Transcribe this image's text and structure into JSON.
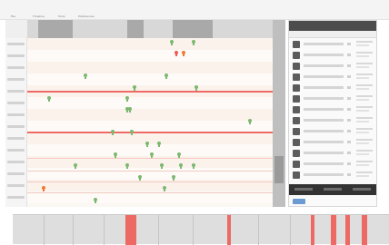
{
  "menubar": {
    "items": [
      {
        "label": "File"
      },
      {
        "label": "Timeline"
      },
      {
        "label": "Tools"
      },
      {
        "label": "Preferences"
      }
    ]
  },
  "timeline": {
    "lanes": 14,
    "markers": [
      {
        "color": "#7cb86f",
        "lane": 3,
        "t": 0.23
      },
      {
        "color": "#7cb86f",
        "lane": 5,
        "t": 0.08
      },
      {
        "color": "#7cb86f",
        "lane": 4,
        "t": 0.43
      },
      {
        "color": "#7cb86f",
        "lane": 3,
        "t": 0.56
      },
      {
        "color": "#7cb86f",
        "lane": 4,
        "t": 0.68
      },
      {
        "color": "#7cb86f",
        "lane": 0,
        "t": 0.58
      },
      {
        "color": "#ef5a50",
        "lane": 1,
        "t": 0.6
      },
      {
        "color": "#ef7a30",
        "lane": 1,
        "t": 0.63
      },
      {
        "color": "#7cb86f",
        "lane": 0,
        "t": 0.67
      },
      {
        "color": "#7cb86f",
        "lane": 5,
        "t": 0.4
      },
      {
        "color": "#7cb86f",
        "lane": 6,
        "t": 0.4
      },
      {
        "color": "#7cb86f",
        "lane": 6,
        "t": 0.41
      },
      {
        "color": "#7cb86f",
        "lane": 7,
        "t": 0.9
      },
      {
        "color": "#7cb86f",
        "lane": 8,
        "t": 0.34
      },
      {
        "color": "#7cb86f",
        "lane": 8,
        "t": 0.42
      },
      {
        "color": "#7cb86f",
        "lane": 9,
        "t": 0.48
      },
      {
        "color": "#7cb86f",
        "lane": 9,
        "t": 0.53
      },
      {
        "color": "#7cb86f",
        "lane": 10,
        "t": 0.35
      },
      {
        "color": "#7cb86f",
        "lane": 10,
        "t": 0.5
      },
      {
        "color": "#7cb86f",
        "lane": 10,
        "t": 0.61
      },
      {
        "color": "#7cb86f",
        "lane": 11,
        "t": 0.19
      },
      {
        "color": "#7cb86f",
        "lane": 11,
        "t": 0.4
      },
      {
        "color": "#7cb86f",
        "lane": 11,
        "t": 0.54
      },
      {
        "color": "#7cb86f",
        "lane": 11,
        "t": 0.62
      },
      {
        "color": "#7cb86f",
        "lane": 11,
        "t": 0.67
      },
      {
        "color": "#7cb86f",
        "lane": 12,
        "t": 0.45
      },
      {
        "color": "#7cb86f",
        "lane": 12,
        "t": 0.59
      },
      {
        "color": "#ef7a30",
        "lane": 13,
        "t": 0.06
      },
      {
        "color": "#7cb86f",
        "lane": 13,
        "t": 0.55
      },
      {
        "color": "#7cb86f",
        "lane": 14,
        "t": 0.27
      }
    ]
  },
  "side_panel": {
    "rows": 13
  }
}
